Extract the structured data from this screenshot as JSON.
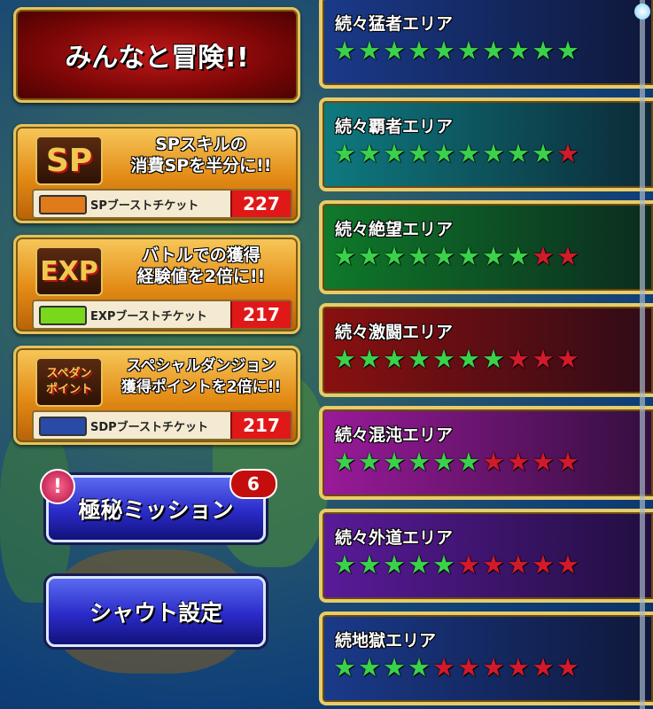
{
  "main_button": {
    "label": "みんなと冒険!!"
  },
  "boosts": [
    {
      "emblem": "SP",
      "description": "SPスキルの\n消費SPを半分に!!",
      "ticket_label": "SPブーストチケット",
      "count": "227"
    },
    {
      "emblem": "EXP",
      "description": "バトルでの獲得\n経験値を2倍に!!",
      "ticket_label": "EXPブーストチケット",
      "count": "217"
    },
    {
      "emblem": "スペダン\nポイント",
      "description": "スペシャルダンジョン\n獲得ポイントを2倍に!!",
      "ticket_label": "SDPブーストチケット",
      "count": "217"
    }
  ],
  "mission_button": {
    "label": "極秘ミッション",
    "badge": "6",
    "alert": "!"
  },
  "shout_button": {
    "label": "シャウト設定"
  },
  "areas": [
    {
      "name": "続々猛者エリア",
      "green_stars": 10,
      "red_stars": 0,
      "color": "#1a3a8a"
    },
    {
      "name": "続々覇者エリア",
      "green_stars": 9,
      "red_stars": 1,
      "color": "#0f7a80"
    },
    {
      "name": "続々絶望エリア",
      "green_stars": 8,
      "red_stars": 2,
      "color": "#0f7a2a"
    },
    {
      "name": "続々激闘エリア",
      "green_stars": 7,
      "red_stars": 3,
      "color": "#8a1010"
    },
    {
      "name": "続々混沌エリア",
      "green_stars": 6,
      "red_stars": 4,
      "color": "#9a1a9a"
    },
    {
      "name": "続々外道エリア",
      "green_stars": 5,
      "red_stars": 5,
      "color": "#5a1a9a"
    },
    {
      "name": "続地獄エリア",
      "green_stars": 4,
      "red_stars": 6,
      "color": "#1a3a8a"
    }
  ],
  "colors": {
    "gold": "#e6c25a",
    "star_green": "#3ad24a",
    "star_red": "#d21a2a"
  }
}
